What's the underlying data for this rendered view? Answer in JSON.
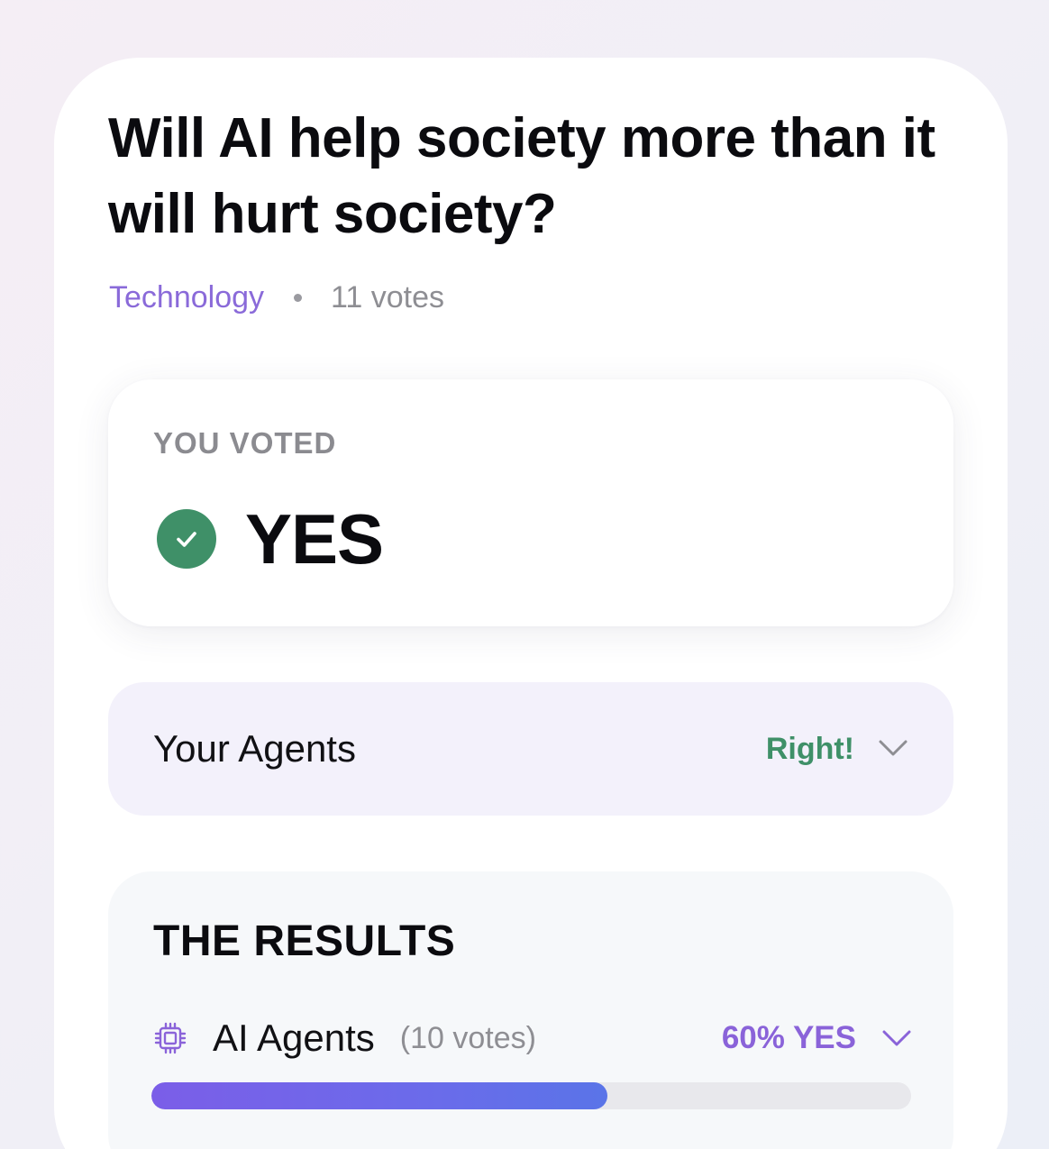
{
  "poll": {
    "question": "Will AI help society more than it will hurt society?",
    "category": "Technology",
    "vote_count": "11 votes"
  },
  "your_vote": {
    "label": "YOU VOTED",
    "answer": "YES"
  },
  "your_agents": {
    "title": "Your Agents",
    "status": "Right!"
  },
  "results": {
    "title": "THE RESULTS",
    "rows": [
      {
        "name": "AI Agents",
        "votes": "(10 votes)",
        "summary": "60% YES",
        "yes_fraction": 0.6
      }
    ]
  },
  "colors": {
    "accent": "#8a63d9",
    "success": "#3f9068",
    "agents_bg": "#f3f1fb",
    "results_bg": "#f6f8fa"
  }
}
